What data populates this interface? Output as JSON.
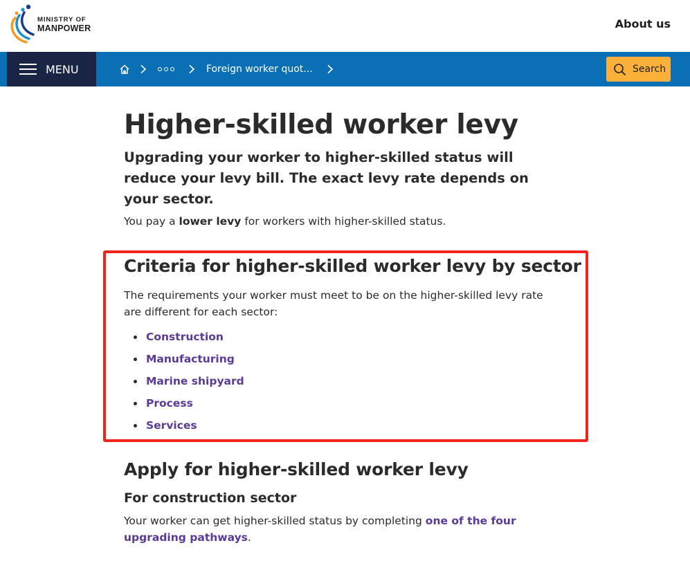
{
  "header": {
    "logo_line1": "MINISTRY OF",
    "logo_line2": "MANPOWER",
    "about_label": "About us"
  },
  "navbar": {
    "menu_label": "MENU",
    "home_icon": "home-icon",
    "breadcrumb_current": "Foreign worker quot...",
    "search_label": "Search",
    "bar_color": "#0a6fb5",
    "menu_bg_color": "#1a2546",
    "search_color": "#fbb03b"
  },
  "page": {
    "title": "Higher-skilled worker levy",
    "lede": "Upgrading your worker to higher-skilled status will reduce your levy bill. The exact levy rate depends on your sector.",
    "intro_prefix": "You pay a ",
    "intro_bold": "lower levy",
    "intro_suffix": " for workers with higher-skilled status."
  },
  "criteria": {
    "heading": "Criteria for higher-skilled worker levy by sector",
    "description": "The requirements your worker must meet to be on the higher-skilled levy rate are different for each sector:",
    "sectors": [
      "Construction",
      "Manufacturing",
      "Marine shipyard",
      "Process",
      "Services"
    ],
    "link_color": "#5b3a96",
    "highlight_color": "#f2231b"
  },
  "apply": {
    "heading": "Apply for higher-skilled worker levy",
    "subheading": "For construction sector",
    "text_prefix": "Your worker can get higher-skilled status by completing ",
    "link_text": "one of the four upgrading pathways",
    "text_suffix": "."
  }
}
